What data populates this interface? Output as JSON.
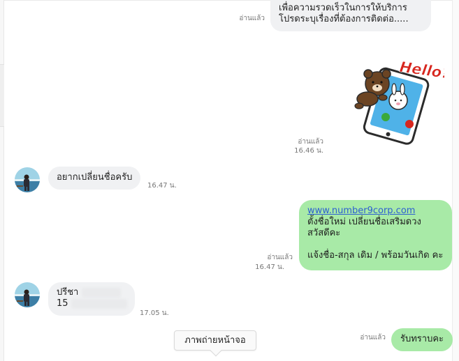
{
  "chat": {
    "messages": [
      {
        "side": "out",
        "lines": [
          "เพื่อความรวดเร็วในการให้บริการ",
          "โปรดระบุเรื่องที่ต้องการติดต่อ....."
        ],
        "read_label": "อ่านแล้ว"
      },
      {
        "side": "out",
        "type": "sticker",
        "sticker_text": "Hello?",
        "read_label": "อ่านแล้ว",
        "time": "16.46 น."
      },
      {
        "side": "in",
        "text": "อยากเปลี่ยนชื่อครับ",
        "time": "16.47 น."
      },
      {
        "side": "out",
        "link": "www.number9corp.com",
        "lines": [
          "ตั้งชื่อใหม่ เปลี่ยนชื่อเสริมดวง",
          "สวัสดีคะ",
          "",
          "แจ้งชื่อ-สกุล เดิม / พร้อมวันเกิด คะ"
        ],
        "read_label": "อ่านแล้ว",
        "time": "16.47 น."
      },
      {
        "side": "in",
        "lines": [
          "ปรีชา",
          "15"
        ],
        "time": "17.05 น."
      },
      {
        "side": "out",
        "text": "รับทราบคะ",
        "read_label": "อ่านแล้ว"
      }
    ]
  },
  "screenshot_button": {
    "label": "ภาพถ่ายหน้าจอ"
  },
  "icons": {
    "avatar": "user-avatar-photo",
    "sticker": "brown-bear-phone-sticker"
  },
  "colors": {
    "incoming_bubble": "#f0f1f3",
    "outgoing_bubble": "#a8eaa7",
    "link": "#2d5fd1",
    "sticker_text": "#d7261e"
  }
}
